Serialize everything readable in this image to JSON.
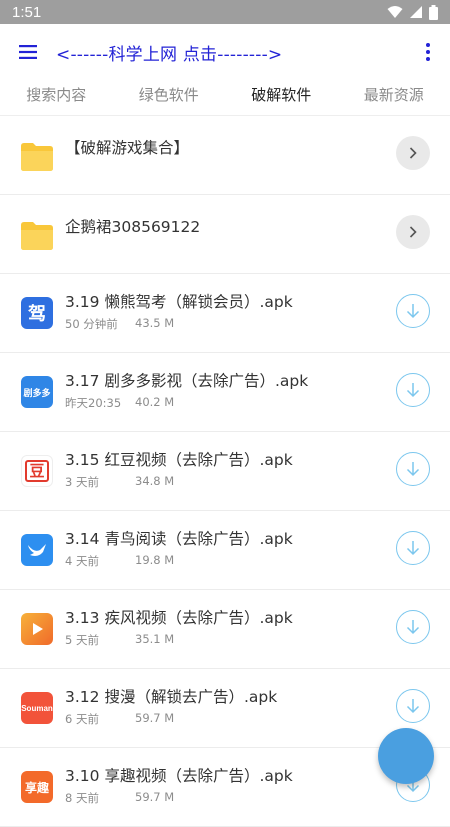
{
  "status": {
    "time": "1:51"
  },
  "app_bar": {
    "title": "<------科学上网  点击-------->"
  },
  "tabs": [
    {
      "label": "搜索内容",
      "active": false
    },
    {
      "label": "绿色软件",
      "active": false
    },
    {
      "label": "破解软件",
      "active": true
    },
    {
      "label": "最新资源",
      "active": false
    }
  ],
  "folders": [
    {
      "title": "【破解游戏集合】"
    },
    {
      "title": "企鹅裙308569122"
    }
  ],
  "files": [
    {
      "title": "3.19 懒熊驾考（解锁会员）.apk",
      "time": "50 分钟前",
      "size": "43.5 M",
      "icon_text": "驾",
      "icon_color": "#2e6fe0"
    },
    {
      "title": "3.17 剧多多影视（去除广告）.apk",
      "time": "昨天20:35",
      "size": "40.2 M",
      "icon_text": "剧多多",
      "icon_color": "#2f86e6"
    },
    {
      "title": "3.15 红豆视频（去除广告）.apk",
      "time": "3 天前",
      "size": "34.8 M",
      "icon_text": "豆",
      "icon_color": "#ffffff"
    },
    {
      "title": "3.14 青鸟阅读（去除广告）.apk",
      "time": "4 天前",
      "size": "19.8 M",
      "icon_text": "",
      "icon_color": "#2d8ff0"
    },
    {
      "title": "3.13 疾风视频（去除广告）.apk",
      "time": "5 天前",
      "size": "35.1 M",
      "icon_text": "",
      "icon_color": "#f7b13a"
    },
    {
      "title": "3.12 搜漫（解锁去广告）.apk",
      "time": "6 天前",
      "size": "59.7 M",
      "icon_text": "Souman",
      "icon_color": "#f2533a"
    },
    {
      "title": "3.10 享趣视频（去除广告）.apk",
      "time": "8 天前",
      "size": "59.7 M",
      "icon_text": "享趣",
      "icon_color": "#f36a2a"
    }
  ]
}
